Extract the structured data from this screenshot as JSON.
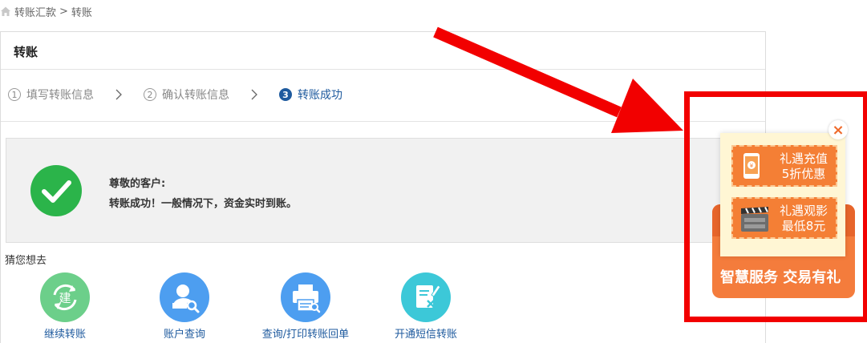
{
  "breadcrumb": {
    "parent": "转账汇款",
    "separator": ">",
    "current": "转账"
  },
  "panel": {
    "title": "转账"
  },
  "steps": [
    {
      "num": "1",
      "label": "填写转账信息",
      "active": false
    },
    {
      "num": "2",
      "label": "确认转账信息",
      "active": false
    },
    {
      "num": "3",
      "label": "转账成功",
      "active": true
    }
  ],
  "success": {
    "greeting": "尊敬的客户:",
    "message": "转账成功！一般情况下，资金实时到账。"
  },
  "guess": {
    "title": "猜您想去",
    "items": [
      {
        "label": "继续转账",
        "icon": "rebuild-icon",
        "color": "#6ccf8a",
        "glyph": "建"
      },
      {
        "label": "账户查询",
        "icon": "user-search-icon",
        "color": "#4d9ef0"
      },
      {
        "label": "查询/打印转账回单",
        "icon": "printer-icon",
        "color": "#4d9ef0"
      },
      {
        "label": "开通短信转账",
        "icon": "sms-edit-icon",
        "color": "#3cc8d8"
      }
    ]
  },
  "popup": {
    "close": "×",
    "coupon1": {
      "line1": "礼遇充值",
      "line2": "5折优惠"
    },
    "coupon2": {
      "line1": "礼遇观影",
      "line2": "最低8元"
    },
    "footer": "智慧服务 交易有礼"
  },
  "colors": {
    "accent": "#1e5a9e",
    "success": "#2bb44a",
    "highlight": "#f20000",
    "promo": "#f47c3c"
  }
}
